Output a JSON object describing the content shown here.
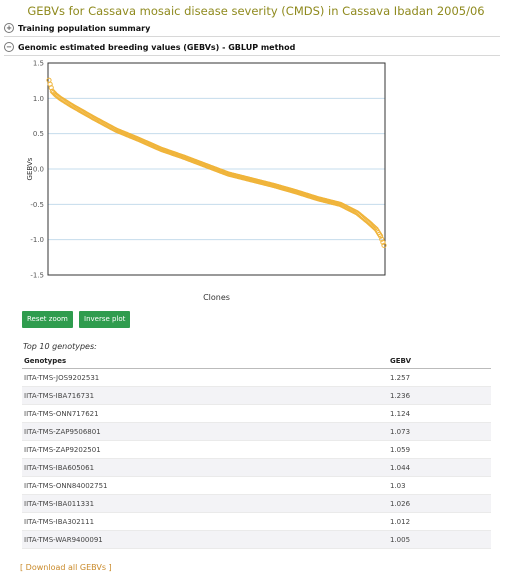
{
  "page": {
    "title": "GEBVs for Cassava mosaic disease severity (CMDS) in Cassava Ibadan 2005/06"
  },
  "sections": {
    "training": {
      "label": "Training population summary",
      "toggle": "+"
    },
    "gebvs": {
      "label": "Genomic estimated breeding values (GEBVs) - GBLUP method",
      "toggle": "−"
    }
  },
  "chart_data": {
    "type": "scatter",
    "xlabel": "Clones",
    "ylabel": "GEBVs",
    "ylim": [
      -1.5,
      1.5
    ],
    "yticks": [
      "1.5",
      "1.0",
      "0.5",
      "0.0",
      "-0.5",
      "-1.0",
      "-1.5"
    ],
    "grid": true,
    "marker_color": "#f0b43a",
    "series_profile": {
      "n_points": 300,
      "x": [
        0,
        1,
        3,
        6,
        10,
        20,
        40,
        60,
        80,
        100,
        120,
        140,
        160,
        180,
        200,
        220,
        240,
        260,
        275,
        285,
        292,
        296,
        299
      ],
      "y": [
        1.257,
        1.2,
        1.1,
        1.05,
        1.0,
        0.9,
        0.72,
        0.55,
        0.42,
        0.28,
        0.17,
        0.05,
        -0.07,
        -0.15,
        -0.23,
        -0.32,
        -0.42,
        -0.5,
        -0.62,
        -0.75,
        -0.85,
        -0.95,
        -1.08
      ]
    }
  },
  "buttons": {
    "reset": "Reset zoom",
    "inverse": "Inverse plot"
  },
  "top10": {
    "heading": "Top 10 genotypes:",
    "columns": [
      "Genotypes",
      "GEBV"
    ],
    "rows": [
      [
        "IITA-TMS-JOS9202531",
        "1.257"
      ],
      [
        "IITA-TMS-IBA716731",
        "1.236"
      ],
      [
        "IITA-TMS-ONN717621",
        "1.124"
      ],
      [
        "IITA-TMS-ZAP9506801",
        "1.073"
      ],
      [
        "IITA-TMS-ZAP9202501",
        "1.059"
      ],
      [
        "IITA-TMS-IBA605061",
        "1.044"
      ],
      [
        "IITA-TMS-ONN84002751",
        "1.03"
      ],
      [
        "IITA-TMS-IBA011331",
        "1.026"
      ],
      [
        "IITA-TMS-IBA302111",
        "1.012"
      ],
      [
        "IITA-TMS-WAR9400091",
        "1.005"
      ]
    ]
  },
  "download": {
    "open": "[ ",
    "link": "Download all GEBVs",
    "close": " ]"
  }
}
